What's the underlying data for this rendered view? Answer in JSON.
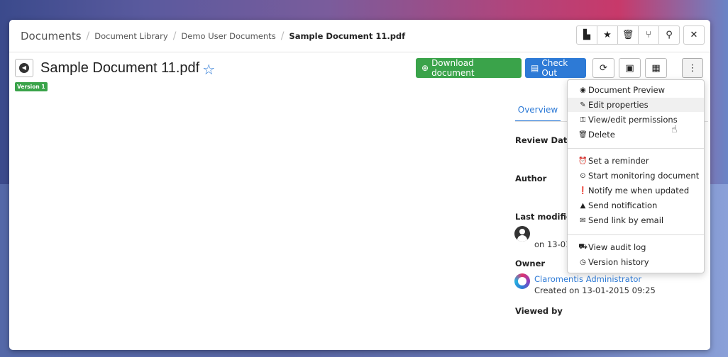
{
  "breadcrumb": {
    "root": "Documents",
    "items": [
      "Document Library",
      "Demo User Documents"
    ],
    "current": "Sample Document 11.pdf"
  },
  "toolbar": {
    "buttons": [
      "new-document-icon",
      "star-icon",
      "trash-icon",
      "branch-icon",
      "search-icon",
      "tools-icon"
    ]
  },
  "document": {
    "title": "Sample Document 11.pdf",
    "version_badge": "Version 1"
  },
  "actions": {
    "download_label": "Download document",
    "checkout_label": "Check Out"
  },
  "tabs": {
    "overview": "Overview"
  },
  "details": {
    "review_date_label": "Review Date",
    "author_label": "Author",
    "last_modified_label": "Last modified",
    "modified_text": "on 13-01-",
    "owner_label": "Owner",
    "owner_name": "Claromentis Administrator",
    "owner_created": "Created on 13-01-2015 09:25",
    "viewed_by_label": "Viewed by"
  },
  "menu": {
    "items": [
      {
        "label": "Document Preview",
        "icon": "eye-icon"
      },
      {
        "label": "Edit properties",
        "icon": "pencil-icon"
      },
      {
        "label": "View/edit permissions",
        "icon": "key-icon"
      },
      {
        "label": "Delete",
        "icon": "trash-icon"
      },
      {
        "label": "Set a reminder",
        "icon": "alarm-icon"
      },
      {
        "label": "Start monitoring document",
        "icon": "play-circle-icon"
      },
      {
        "label": "Notify me when updated",
        "icon": "alert-circle-icon"
      },
      {
        "label": "Send notification",
        "icon": "warning-icon"
      },
      {
        "label": "Send link by email",
        "icon": "envelope-icon"
      },
      {
        "label": "View audit log",
        "icon": "camera-icon"
      },
      {
        "label": "Version history",
        "icon": "clock-icon"
      }
    ]
  },
  "colors": {
    "primary": "#2d7ad6",
    "success": "#3aa34a"
  }
}
